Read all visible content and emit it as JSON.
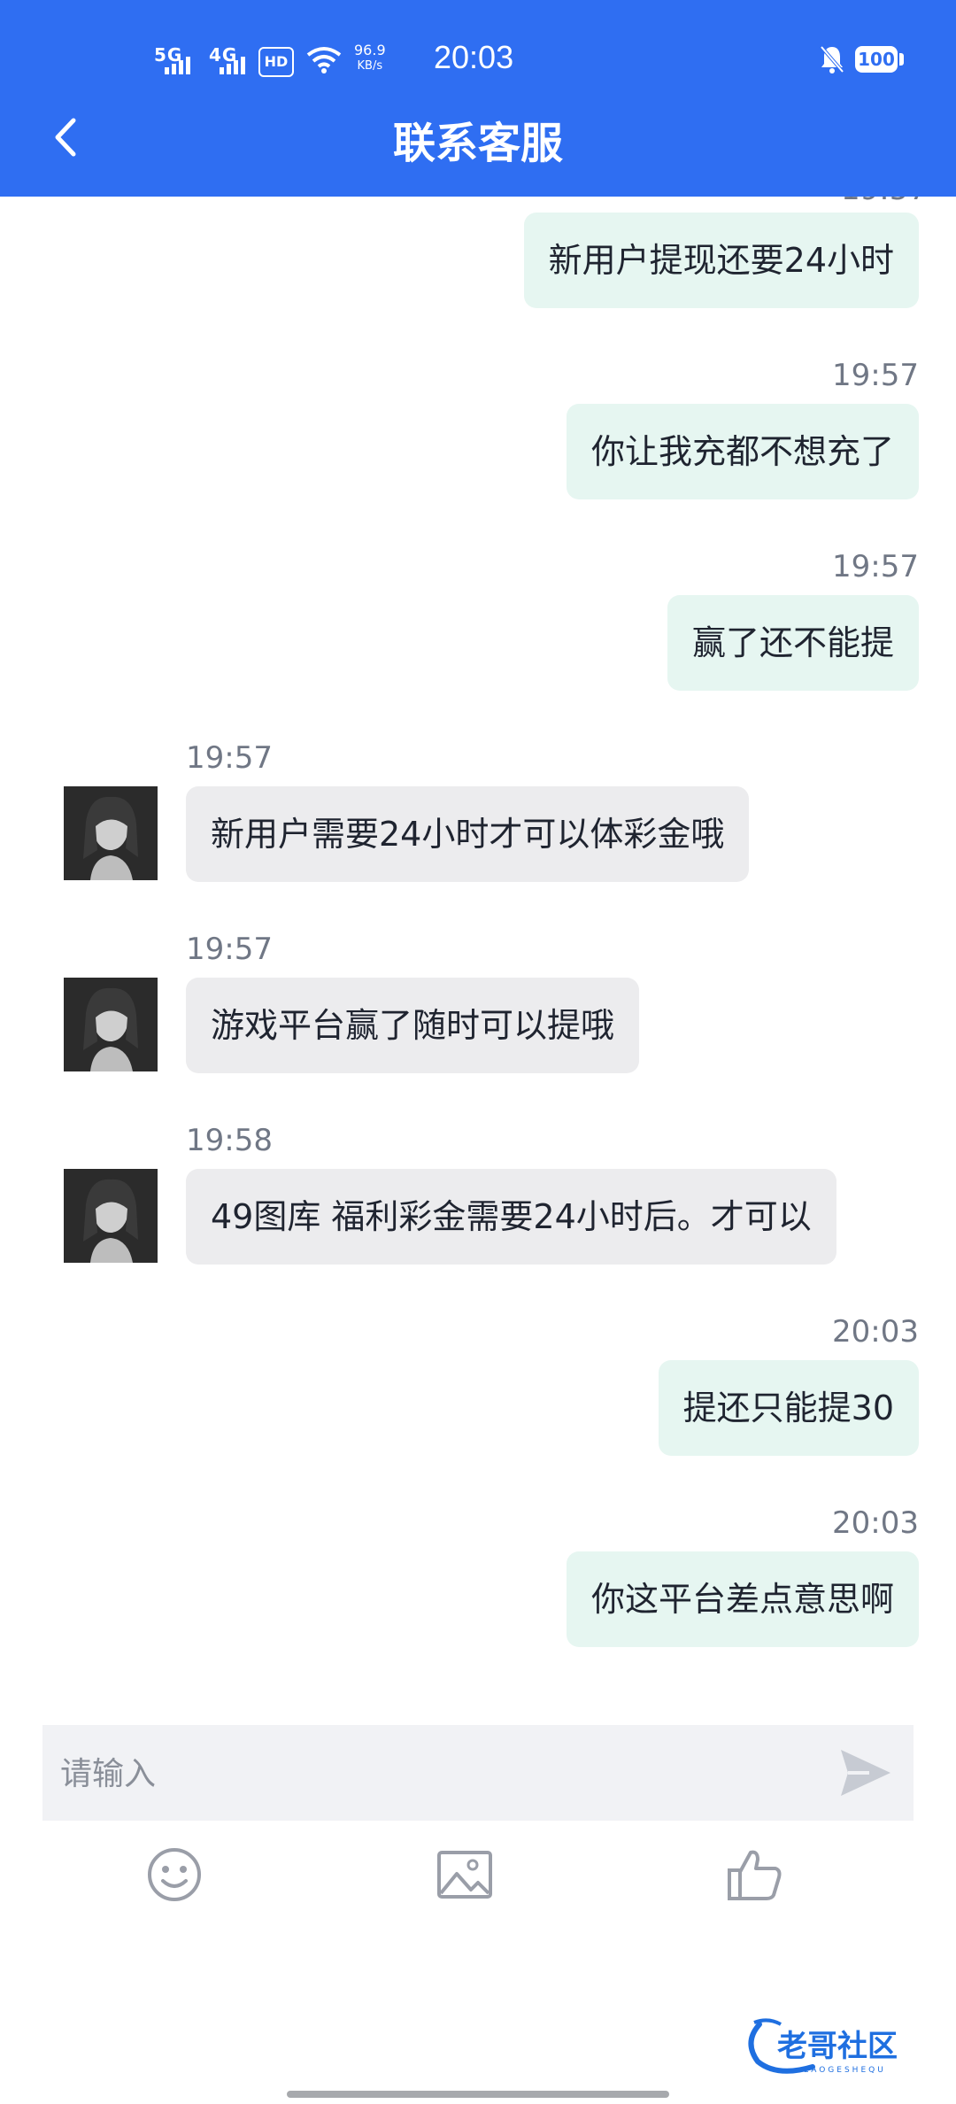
{
  "status_bar": {
    "network1": "5G",
    "network2": "4G",
    "hd": "HD",
    "speed_value": "96.9",
    "speed_unit": "KB/s",
    "time": "20:03",
    "battery": "100"
  },
  "header": {
    "title": "联系客服"
  },
  "messages": [
    {
      "side": "me",
      "time": "",
      "text": "新用户提现还要24小时"
    },
    {
      "side": "me",
      "time": "19:57",
      "text": "你让我充都不想充了"
    },
    {
      "side": "me",
      "time": "19:57",
      "text": "赢了还不能提"
    },
    {
      "side": "other",
      "time": "19:57",
      "text": "新用户需要24小时才可以体彩金哦"
    },
    {
      "side": "other",
      "time": "19:57",
      "text": "游戏平台赢了随时可以提哦"
    },
    {
      "side": "other",
      "time": "19:58",
      "text": "49图库 福利彩金需要24小时后。才可以"
    },
    {
      "side": "me",
      "time": "20:03",
      "text": "提还只能提30"
    },
    {
      "side": "me",
      "time": "20:03",
      "text": "你这平台差点意思啊"
    }
  ],
  "input": {
    "placeholder": "请输入"
  },
  "toolbar": {
    "icons": [
      "emoji-icon",
      "image-icon",
      "thumbs-up-icon"
    ]
  },
  "colors": {
    "header": "#2f6ef2",
    "my_bubble": "#e6f6f1",
    "other_bubble": "#ececee"
  }
}
